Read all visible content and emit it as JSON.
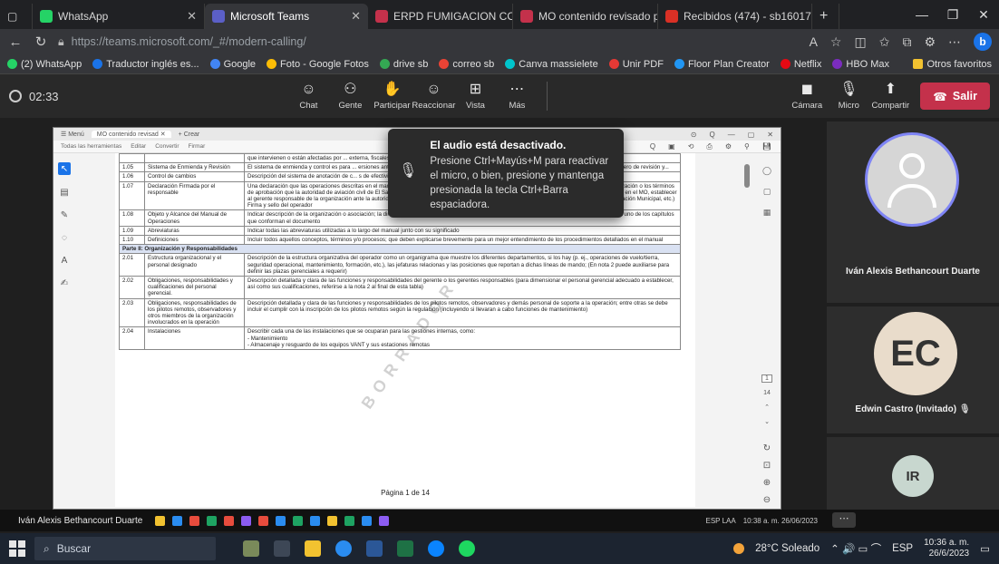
{
  "browser": {
    "tabs": [
      {
        "label": "WhatsApp",
        "color": "#25d366",
        "active": false
      },
      {
        "label": "Microsoft Teams",
        "color": "#5b5fc7",
        "active": true
      },
      {
        "label": "ERPD FUMIGACION CON DR",
        "color": "#c4314b",
        "active": false
      },
      {
        "label": "MO contenido revisado para",
        "color": "#c4314b",
        "active": false
      },
      {
        "label": "Recibidos (474) - sb16017@u",
        "color": "#d93025",
        "active": false
      }
    ],
    "url": "https://teams.microsoft.com/_#/modern-calling/",
    "bookmarks": [
      {
        "label": "(2) WhatsApp",
        "color": "#25d366"
      },
      {
        "label": "Traductor inglés es...",
        "color": "#1a73e8"
      },
      {
        "label": "Google",
        "color": "#4285f4"
      },
      {
        "label": "Foto - Google Fotos",
        "color": "#fbbc05"
      },
      {
        "label": "drive sb",
        "color": "#34a853"
      },
      {
        "label": "correo sb",
        "color": "#ea4335"
      },
      {
        "label": "Canva massielete",
        "color": "#00c4cc"
      },
      {
        "label": "Unir PDF",
        "color": "#e53935"
      },
      {
        "label": "Floor Plan Creator",
        "color": "#2196f3"
      },
      {
        "label": "Netflix",
        "color": "#e50914"
      },
      {
        "label": "HBO Max",
        "color": "#7b2cbf"
      }
    ],
    "other_favorites": "Otros favoritos"
  },
  "teams": {
    "timer": "02:33",
    "buttons": [
      {
        "label": "Chat",
        "glyph": "☺"
      },
      {
        "label": "Gente",
        "glyph": "⚇"
      },
      {
        "label": "Participar",
        "glyph": "✋"
      },
      {
        "label": "Reaccionar",
        "glyph": "☺"
      },
      {
        "label": "Vista",
        "glyph": "⊞"
      },
      {
        "label": "Más",
        "glyph": "⋯"
      }
    ],
    "media": [
      {
        "label": "Cámara",
        "glyph": "◼"
      },
      {
        "label": "Micro",
        "glyph": "🎙"
      },
      {
        "label": "Compartir",
        "glyph": "⬆"
      }
    ],
    "leave": "Salir"
  },
  "toast": {
    "title": "El audio está desactivado.",
    "body": "Presione Ctrl+Mayús+M para reactivar el micro, o bien, presione y mantenga presionada la tecla Ctrl+Barra espaciadora."
  },
  "document": {
    "tab_title": "MO contenido revisad",
    "new_tab": "Crear",
    "toolbar": [
      "Todas las herramientas",
      "Editar",
      "Convertir",
      "Firmar"
    ],
    "rows": [
      {
        "n": "",
        "h": "",
        "d": "que intervienen o están afectadas por ... externa, fiscales, comunicaciones, sistema de archivo (físico..."
      },
      {
        "n": "1.05",
        "h": "Sistema de Enmienda y Revisión",
        "d": "El sistema de enmienda y control es para ... ersiones anteriores no sean usadas. Las enmiendas deben s... ción. Por esto es requerido el incluir el número de revisión y..."
      },
      {
        "n": "1.06",
        "h": "Control de cambios",
        "d": "Descripción del sistema de anotación de c... s de efectividad."
      },
      {
        "n": "1.07",
        "h": "Declaración Firmada por el responsable",
        "d": "Una declaración que las operaciones descritas en el manual están en cumplimiento con los requerimientos de la regulación [XXXXXXX] y con la autorización o los términos de aprobación que la autoridad de aviación civil de El Salvador determine; manifestar el compromiso del operador para el cumplimiento de lo contenido en el MO, establecer al gerente responsable de la organización ante la autoridad de aviación civil; los datos legales de la organización (Registro Mercantil, Permiso de Operación Municipal, etc.)    Firma y sello del operador"
      },
      {
        "n": "1.08",
        "h": "Objeto y Alcance del Manual de Operaciones",
        "d": "Indicar descripción de la organización o asociación; la dirección desde donde se gestionarán las operaciones, así como una breve descripción de cada uno de los capítulos que conforman el documento"
      },
      {
        "n": "1.09",
        "h": "Abreviaturas",
        "d": "Indicar todas las abreviaturas utilizadas a lo largo del manual junto con su significado"
      },
      {
        "n": "1.10",
        "h": "Definiciones",
        "d": "Incluir todos aquellos conceptos, términos y/o procesos; que deben explicarse brevemente para un mejor entendimiento de los procedimientos detallados en el manual"
      },
      {
        "part": "Parte II: Organización y Responsabilidades"
      },
      {
        "n": "2.01",
        "h": "Estructura organizacional y el personal designado",
        "d": "Descripción de la estructura organizativa del operador como un organigrama que muestre los diferentes departamentos, si los hay (p. ej., operaciones de vuelo/tierra, seguridad operacional, mantenimiento, formación, etc.), las jefaturas relacionas y las posiciones que reportan a dichas líneas de mando; (En nota 2 puede auxiliarse para definir las plazas gerenciales a requerir)"
      },
      {
        "n": "2.02",
        "h": "Obligaciones, responsabilidades y cualificaciones del personal gerencial.",
        "d": "Descripción detallada y clara de las funciones y responsabilidades del gerente o los gerentes responsables (para dimensionar el personal gerencial adecuado a establecer, así como sus cualificaciones, referirse a la nota 2 al final de esta tabla)"
      },
      {
        "n": "2.03",
        "h": "Obligaciones, responsabilidades de los pilotos remotos, observadores y otros miembros de la organización involucrados en la operación",
        "d": "Descripción detallada y clara de las funciones y responsabilidades de los pilotos remotos, observadores y demás personal de soporte a la operación; entre otras se debe incluir el cumplir con la inscripción de los pilotos remotos según la regulación (incluyendo si llevaran a cabo funciones de mantenimiento)"
      },
      {
        "n": "2.04",
        "h": "Instalaciones",
        "d": "Describir cada una de las instalaciones que se ocuparan para las gestiones internas, como:\n- Mantenimiento\n- Almacenaje y resguardo de los equipos VANT y sus estaciones remotas"
      }
    ],
    "page_label": "Página 1 de 14",
    "page_current": "1",
    "page_total": "14"
  },
  "participants": [
    {
      "name": "Iván Alexis Bethancourt Duarte",
      "initials": "",
      "color": "#c9c9c9"
    },
    {
      "name": "Edwin Castro (Invitado)",
      "initials": "EC",
      "color": "#e9dccb"
    },
    {
      "name": "",
      "initials": "IR",
      "color": "#c8d7cf"
    }
  ],
  "meeting_strip": {
    "presenter": "Iván Alexis Bethancourt Duarte",
    "tray_lang": "ESP LAA",
    "tray_time": "10:38 a. m. 26/06/2023"
  },
  "taskbar": {
    "search": "Buscar",
    "weather": "28°C Soleado",
    "lang": "ESP",
    "time": "10:36 a. m.",
    "date": "26/6/2023"
  }
}
